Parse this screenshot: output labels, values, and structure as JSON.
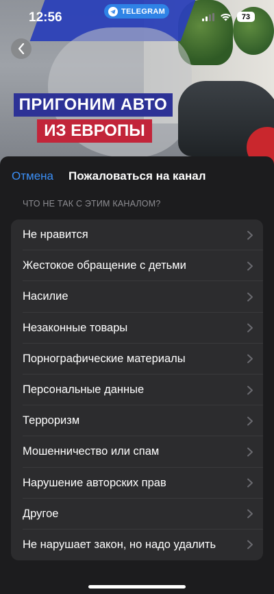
{
  "status_bar": {
    "time": "12:56",
    "app_pill": "TELEGRAM",
    "battery": "73"
  },
  "background": {
    "banner_line1": "ПРИГОНИМ АВТО",
    "banner_line2": "ИЗ ЕВРОПЫ"
  },
  "sheet": {
    "cancel_label": "Отмена",
    "title": "Пожаловаться на канал",
    "section_header": "ЧТО НЕ ТАК С ЭТИМ КАНАЛОМ?",
    "options": [
      {
        "label": "Не нравится"
      },
      {
        "label": "Жестокое обращение с детьми"
      },
      {
        "label": "Насилие"
      },
      {
        "label": "Незаконные товары"
      },
      {
        "label": "Порнографические материалы"
      },
      {
        "label": "Персональные данные"
      },
      {
        "label": "Терроризм"
      },
      {
        "label": "Мошенничество или спам"
      },
      {
        "label": "Нарушение авторских прав"
      },
      {
        "label": "Другое"
      },
      {
        "label": "Не нарушает закон, но надо удалить"
      }
    ]
  },
  "colors": {
    "accent": "#3b8ff6",
    "sheet_bg": "#1c1c1e",
    "list_bg": "#2c2c2e",
    "telegram_blue": "#2f83e6"
  }
}
